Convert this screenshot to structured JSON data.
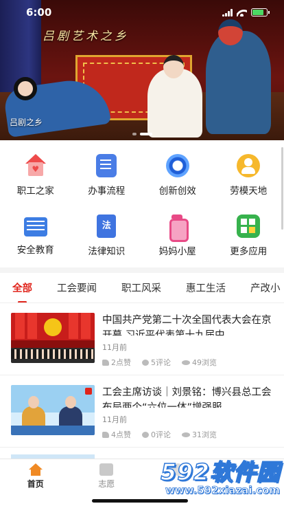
{
  "status_bar": {
    "time": "6:00",
    "battery_color": "#4cd964"
  },
  "banner": {
    "title_art": "吕剧艺术之乡",
    "caption": "吕剧之乡",
    "slide_count": 2,
    "active_slide": 2
  },
  "quick_grid": {
    "items": [
      {
        "label": "职工之家",
        "icon": "home-heart-icon",
        "color": "#ee4b4b"
      },
      {
        "label": "办事流程",
        "icon": "document-edit-icon",
        "color": "#4a7de6"
      },
      {
        "label": "创新创效",
        "icon": "innovation-ring-icon",
        "color": "#1f5fd8"
      },
      {
        "label": "劳模天地",
        "icon": "model-worker-icon",
        "color": "#f6b82c"
      },
      {
        "label": "安全教育",
        "icon": "safety-list-icon",
        "color": "#3d7de3"
      },
      {
        "label": "法律知识",
        "icon": "law-book-icon",
        "glyph": "法",
        "color": "#3f74e0"
      },
      {
        "label": "妈妈小屋",
        "icon": "baby-bottle-icon",
        "color": "#e84a86"
      },
      {
        "label": "更多应用",
        "icon": "more-apps-icon",
        "color": "#37b24d"
      }
    ]
  },
  "tabs": {
    "items": [
      "全部",
      "工会要闻",
      "职工风采",
      "惠工生活",
      "产改小"
    ],
    "active_index": 0,
    "accent": "#e0241b"
  },
  "news": {
    "items": [
      {
        "title": "中国共产党第二十次全国代表大会在京开幕 习近平代表第十九届中...",
        "date": "11月前",
        "likes": "2点赞",
        "comments": "5评论",
        "views": "49浏览"
      },
      {
        "title": "工会主席访谈｜刘景铭：博兴县总工会布局两个“六位一体”增强服...",
        "date": "11月前",
        "likes": "4点赞",
        "comments": "0评论",
        "views": "31浏览"
      }
    ]
  },
  "bottom_nav": {
    "items": [
      {
        "label": "首页",
        "icon": "home-icon",
        "active": true
      },
      {
        "label": "志愿",
        "icon": "volunteer-icon",
        "active": false
      },
      {
        "label": "",
        "icon": "service-icon",
        "active": false
      },
      {
        "label": "",
        "icon": "profile-icon",
        "active": false
      }
    ]
  },
  "watermark": {
    "brand": "592软件园",
    "url": "www.592xiazai.com",
    "color": "#2f78d8"
  }
}
